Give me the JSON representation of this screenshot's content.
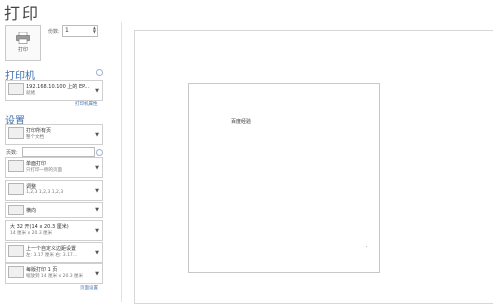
{
  "title": "打印",
  "print_button": {
    "label": "打印"
  },
  "copies": {
    "label": "份数:",
    "value": "1"
  },
  "printer": {
    "heading": "打印机",
    "name": "192.168.10.100 上的 EP...",
    "status": "就绪",
    "properties_link": "打印机属性"
  },
  "settings": {
    "heading": "设置",
    "what": {
      "t1": "打印所有页",
      "t2": "整个文档"
    },
    "pages_label": "页数:",
    "pages_value": "",
    "sides": {
      "t1": "单面打印",
      "t2": "只打印一侧的页面"
    },
    "collate": {
      "t1": "调整",
      "t2": "1,2,3    1,2,3    1,2,3"
    },
    "orientation": {
      "t1": "横向"
    },
    "paper": {
      "t1": "大 32 开(14 x 20.3 厘米)",
      "t2": "14 厘米 x 20.3 厘米"
    },
    "margins": {
      "t1": "上一个自定义边距设置",
      "t2": "左: 3.17 厘米  右: 3.17..."
    },
    "scaling": {
      "t1": "每版打印 1 页",
      "t2": "缩放到 14 厘米 x 20.3 厘米"
    },
    "page_setup_link": "页面设置"
  },
  "preview": {
    "page_text": "百度经验"
  },
  "colors": {
    "accent": "#3f6fae"
  }
}
